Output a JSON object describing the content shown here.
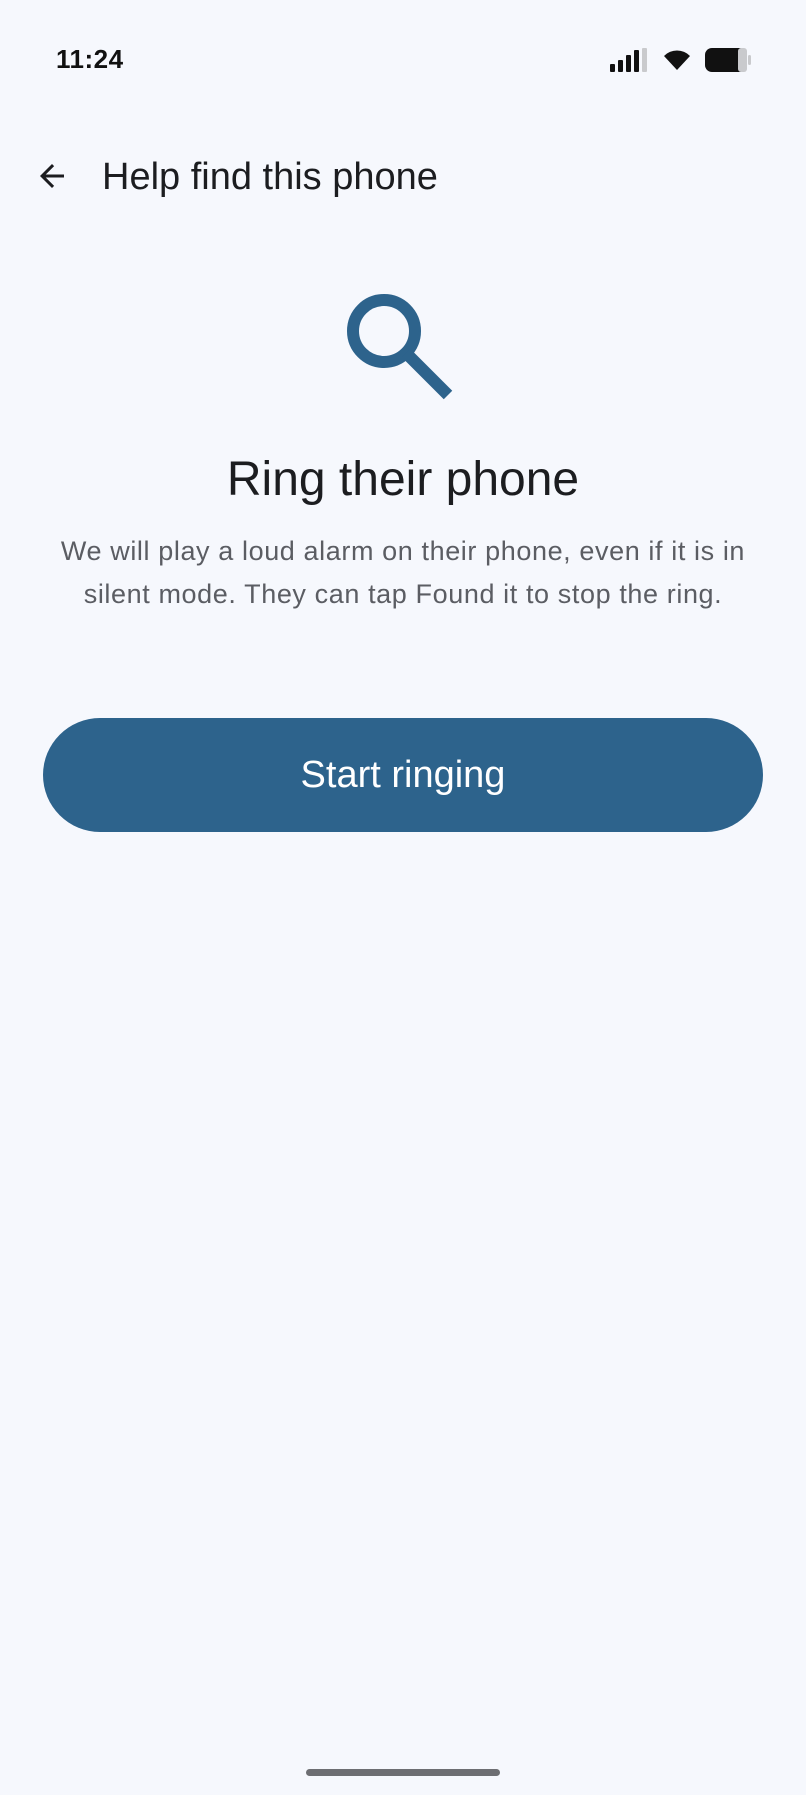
{
  "status_bar": {
    "time": "11:24",
    "icons": [
      "signal-icon",
      "wifi-icon",
      "battery-icon"
    ]
  },
  "app_bar": {
    "back_icon": "arrow-back-icon",
    "title": "Help find this phone"
  },
  "content": {
    "hero_icon": "search-icon",
    "heading": "Ring their phone",
    "description": "We will play a loud alarm on their phone, even if it is in silent mode. They can tap Found it to stop the ring."
  },
  "actions": {
    "start_ringing_label": "Start ringing"
  },
  "colors": {
    "background": "#f6f8fd",
    "accent": "#2d638c",
    "text_primary": "#1c1d20",
    "text_secondary": "#5b5d63"
  }
}
